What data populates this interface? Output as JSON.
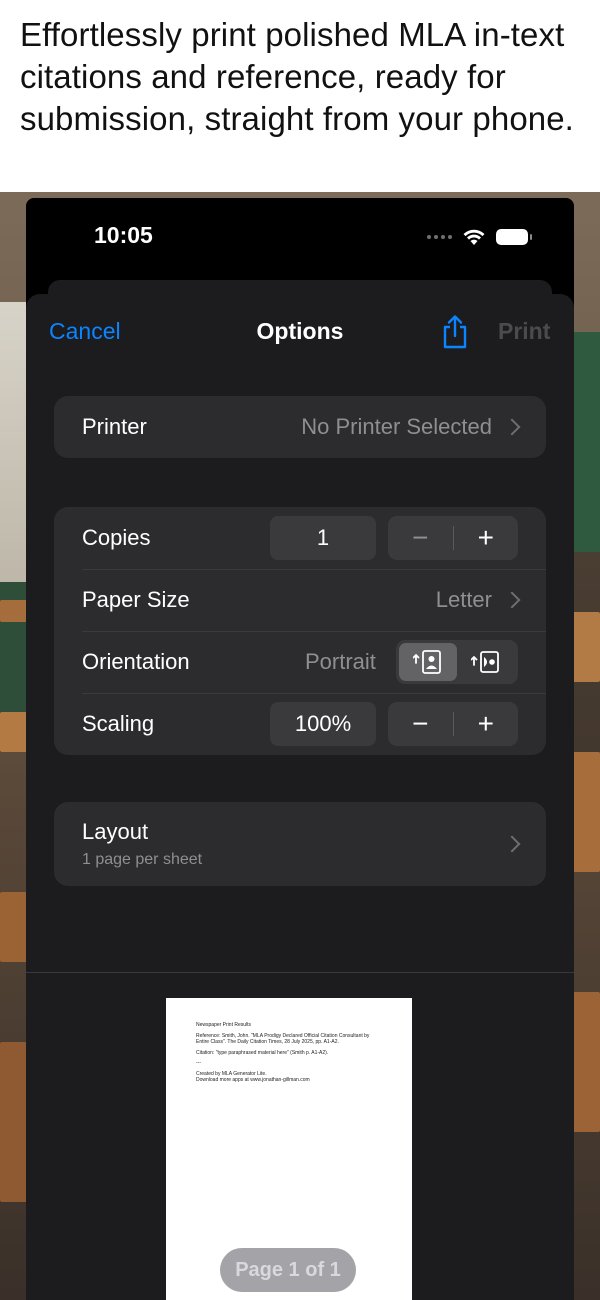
{
  "headline": "Effortlessly print polished MLA in-text citations and reference, ready for submission, straight from your phone.",
  "status_bar": {
    "time": "10:05",
    "icons": [
      "cellular-dots-icon",
      "wifi-icon",
      "battery-icon"
    ]
  },
  "nav": {
    "cancel_label": "Cancel",
    "title": "Options",
    "share_icon": "share-icon",
    "print_label": "Print"
  },
  "printer": {
    "label": "Printer",
    "value": "No Printer Selected"
  },
  "settings": {
    "copies_label": "Copies",
    "copies_value": "1",
    "paper_size_label": "Paper Size",
    "paper_size_value": "Letter",
    "orientation_label": "Orientation",
    "orientation_value": "Portrait",
    "scaling_label": "Scaling",
    "scaling_value": "100%",
    "minus": "−",
    "plus": "+"
  },
  "layout": {
    "label": "Layout",
    "value": "1 page per sheet"
  },
  "preview": {
    "line1": "Newspaper Print Results",
    "line2": "Reference: Smith, John. \"MLA Prodigy Declared Official Citation Consultant by Entire Class\". The Daily Citation Times, 28 July 2025, pp. A1-A2.",
    "line3": "Citation: \"type paraphrased material here\" (Smith p. A1-A2).",
    "line4": "---",
    "line5": "Created by MLA Generator Lite.",
    "line6": "Download more apps at www.jonathan-gillman.com",
    "page_indicator": "Page 1 of 1"
  },
  "colors": {
    "accent": "#0a84ff",
    "sheet": "#1c1c1e",
    "cell": "#2c2c2e"
  }
}
